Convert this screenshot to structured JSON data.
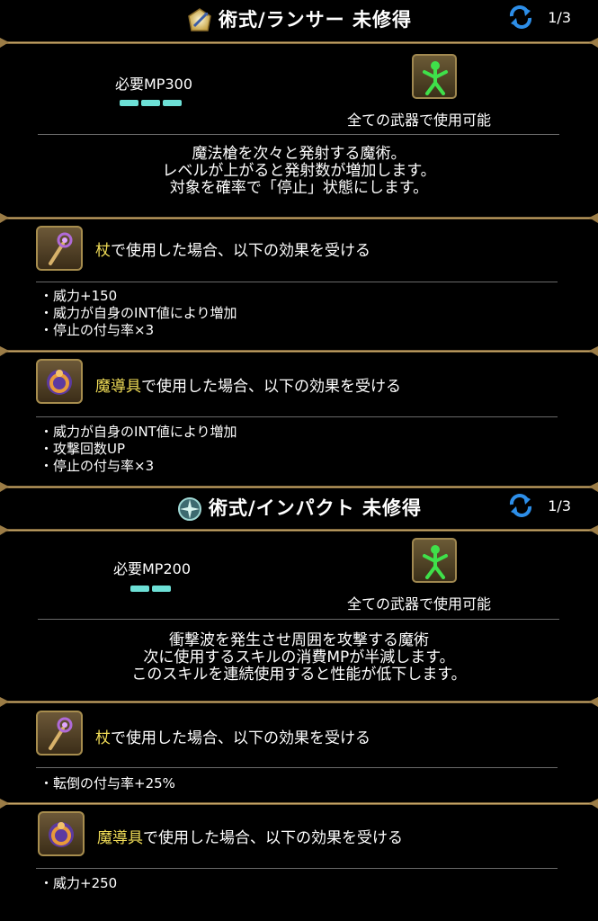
{
  "skills": [
    {
      "title": "術式/ランサー 未修得",
      "pager": "1/3",
      "mp_label": "必要MP300",
      "mp_segments": 3,
      "usable": "全ての武器で使用可能",
      "desc": [
        "魔法槍を次々と発射する魔術。",
        "レベルが上がると発射数が増加します。",
        "対象を確率で「停止」状態にします。"
      ],
      "staff": {
        "weapon": "杖",
        "rest": "で使用した場合、以下の効果を受ける",
        "effects": [
          "威力+150",
          "威力が自身のINT値により増加",
          "停止の付与率×3"
        ]
      },
      "tool": {
        "weapon": "魔導具",
        "rest": "で使用した場合、以下の効果を受ける",
        "effects": [
          "威力が自身のINT値により増加",
          "攻撃回数UP",
          "停止の付与率×3"
        ]
      }
    },
    {
      "title": "術式/インパクト 未修得",
      "pager": "1/3",
      "mp_label": "必要MP200",
      "mp_segments": 2,
      "usable": "全ての武器で使用可能",
      "desc": [
        "衝撃波を発生させ周囲を攻撃する魔術",
        "次に使用するスキルの消費MPが半減します。",
        "このスキルを連続使用すると性能が低下します。"
      ],
      "staff": {
        "weapon": "杖",
        "rest": "で使用した場合、以下の効果を受ける",
        "effects": [
          "転倒の付与率+25%"
        ]
      },
      "tool": {
        "weapon": "魔導具",
        "rest": "で使用した場合、以下の効果を受ける",
        "effects": [
          "威力+250"
        ]
      }
    }
  ],
  "colors": {
    "mp_bar": "#6de0d6",
    "highlight": "#f0dc57",
    "figure": "#3fe04a"
  },
  "icons": {
    "skill1": "lance-crystal-icon",
    "skill2": "impact-rune-icon",
    "cycle": "cycle-arrows-icon",
    "weapon": "all-weapons-figure-icon",
    "staff": "staff-icon",
    "tool": "magic-ring-icon"
  }
}
